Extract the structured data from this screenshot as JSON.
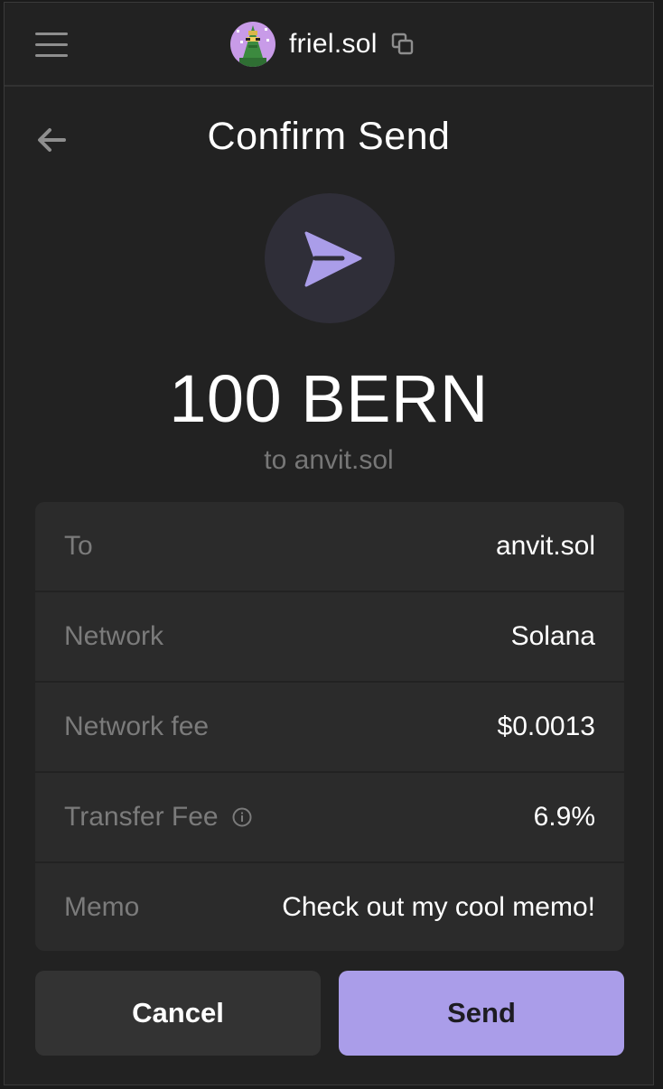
{
  "header": {
    "account_name": "friel.sol",
    "menu_icon": "hamburger-menu-icon",
    "copy_icon": "copy-icon",
    "avatar_icon": "pixel-art-avatar"
  },
  "page": {
    "title": "Confirm Send",
    "back_icon": "arrow-left-icon",
    "send_icon": "paper-plane-icon",
    "amount": "100 BERN",
    "recipient_line": "to anvit.sol"
  },
  "details": [
    {
      "label": "To",
      "value": "anvit.sol"
    },
    {
      "label": "Network",
      "value": "Solana"
    },
    {
      "label": "Network fee",
      "value": "$0.0013"
    },
    {
      "label": "Transfer Fee",
      "value": "6.9%",
      "info_icon": "info-circle-icon"
    },
    {
      "label": "Memo",
      "value": "Check out my cool memo!"
    }
  ],
  "actions": {
    "cancel_label": "Cancel",
    "send_label": "Send"
  },
  "colors": {
    "background": "#222222",
    "card": "#2b2b2b",
    "accent": "#aa9de9",
    "muted_text": "#7b7b7b"
  }
}
